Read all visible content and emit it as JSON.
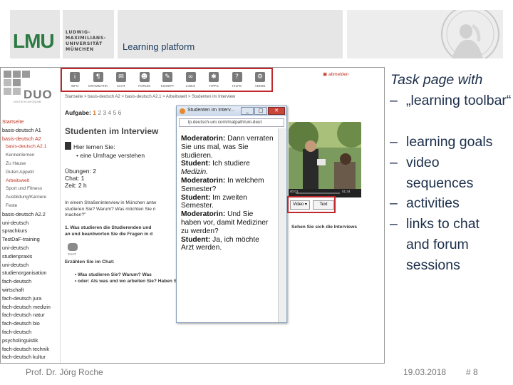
{
  "header": {
    "logo_text": "LMU",
    "university_name": [
      "LUDWIG-",
      "MAXIMILIANS-",
      "UNIVERSITÄT",
      "MÜNCHEN"
    ],
    "platform_label": "Learning platform"
  },
  "screenshot": {
    "toolbar": [
      {
        "icon": "info-icon",
        "label": "INFO"
      },
      {
        "icon": "grammar-icon",
        "label": "GRAMMATIK"
      },
      {
        "icon": "chat-icon",
        "label": "CHAT"
      },
      {
        "icon": "forum-icon",
        "label": "FORUM"
      },
      {
        "icon": "notebook-icon",
        "label": "KOSEPT"
      },
      {
        "icon": "links-icon",
        "label": "LINKS"
      },
      {
        "icon": "tips-icon",
        "label": "TIPPS"
      },
      {
        "icon": "help-icon",
        "label": "HILFE"
      },
      {
        "icon": "admin-icon",
        "label": "ADMIN"
      }
    ],
    "logout": "abmelden",
    "duo_logo": "DUO",
    "duo_tagline": "DEUTSCH UNI ONLINE",
    "breadcrumb": "Startseite > basis-deutsch A2 > basis-deutsch A2.1 > Arbeitswelt > Studenten im Interview",
    "task_label": "Aufgabe:",
    "task_current": "1",
    "task_pages": "2 3 4 5 6",
    "heading": "Studenten im Interview",
    "learn_title": "Hier lernen Sie:",
    "learn_item": "• eine Umfrage verstehen",
    "stats": [
      "Übungen: 2",
      "Chat: 1",
      "Zeit: 2 h"
    ],
    "intro_lines": [
      "In einem Straßeninterview in München antw",
      "studieren Sie? Warum? Was möchten Sie n",
      "machen?\""
    ],
    "question1_lines": [
      "1. Was studieren die Studierenden und",
      "an und beantworten Sie die Fragen in d"
    ],
    "question1_tail": "Sehen Sie sich die Interviews",
    "chat_label": "CHAT",
    "chat_prompt": "Erzählen Sie im Chat:",
    "chat_bullets": [
      "• Was studieren Sie? Warum? Was",
      "• oder: Als was und wo arbeiten Sie? Haben Sie studiert oder eine Ausbildung gemacht?"
    ],
    "sidebar": [
      {
        "text": "Startseite",
        "style": "red"
      },
      {
        "text": "basis-deutsch A1",
        "style": "normal"
      },
      {
        "text": "basis-deutsch A2",
        "style": "red"
      },
      {
        "text": "basis-deutsch A2.1",
        "style": "subred"
      },
      {
        "text": "Kennenlernen",
        "style": "sub"
      },
      {
        "text": "Zu Hause",
        "style": "sub"
      },
      {
        "text": "Guten Appetit",
        "style": "sub"
      },
      {
        "text": "Arbeitswelt",
        "style": "subred"
      },
      {
        "text": "Sport und Fitness",
        "style": "sub"
      },
      {
        "text": "Ausbildung/Karriere",
        "style": "sub"
      },
      {
        "text": "Feste",
        "style": "sub"
      },
      {
        "text": "basis-deutsch A2.2",
        "style": "normal"
      },
      {
        "text": "uni-deutsch",
        "style": "normal"
      },
      {
        "text": "sprachkurs",
        "style": "normal"
      },
      {
        "text": "TestDaF-training",
        "style": "normal"
      },
      {
        "text": "uni-deutsch",
        "style": "normal"
      },
      {
        "text": "studienpraxis",
        "style": "normal"
      },
      {
        "text": "uni-deutsch",
        "style": "normal"
      },
      {
        "text": "studienorganisation",
        "style": "normal"
      },
      {
        "text": "fach-deutsch",
        "style": "normal"
      },
      {
        "text": "wirtschaft",
        "style": "normal"
      },
      {
        "text": "fach-deutsch jura",
        "style": "normal"
      },
      {
        "text": "fach-deutsch medizin",
        "style": "normal"
      },
      {
        "text": "fach-deutsch natur",
        "style": "normal"
      },
      {
        "text": "fach-deutsch bio",
        "style": "normal"
      },
      {
        "text": "fach-deutsch",
        "style": "normal"
      },
      {
        "text": "psycholinguistik",
        "style": "normal"
      },
      {
        "text": "fach-deutsch technik",
        "style": "normal"
      },
      {
        "text": "fach-deutsch kultur",
        "style": "normal"
      }
    ],
    "popup": {
      "title": "Studenten im Interv...",
      "url": "lp.deutsch-uni.com/matpath/uni-deut",
      "transcript": [
        {
          "speaker": "Moderatorin:",
          "text": "Dann verraten"
        },
        {
          "speaker": "",
          "text": "Sie uns mal, was Sie"
        },
        {
          "speaker": "",
          "text": "studieren."
        },
        {
          "speaker": "Student:",
          "text": "Ich studiere"
        },
        {
          "speaker": "",
          "text": "Medizin.",
          "italic": true
        },
        {
          "speaker": "Moderatorin:",
          "text": "In welchem"
        },
        {
          "speaker": "",
          "text": "Semester?"
        },
        {
          "speaker": "Student:",
          "text": "Im zweiten"
        },
        {
          "speaker": "",
          "text": "Semester."
        },
        {
          "speaker": "Moderatorin:",
          "text": "Und Sie"
        },
        {
          "speaker": "",
          "text": "haben vor, damit Mediziner"
        },
        {
          "speaker": "",
          "text": "zu werden?"
        },
        {
          "speaker": "Student:",
          "text": "Ja, ich möchte"
        },
        {
          "speaker": "",
          "text": "Arzt werden."
        }
      ]
    },
    "video": {
      "time_start": "00:01",
      "time_end": "01:34",
      "mode_select": "Video",
      "text_button": "Text"
    }
  },
  "bullets": {
    "heading": "Task page with",
    "items": [
      "„learning toolbar“",
      "learning goals",
      "video sequences",
      "activities",
      "links to chat and forum sessions"
    ]
  },
  "footer": {
    "author": "Prof. Dr. Jörg Roche",
    "date": "19.03.2018",
    "page": "# 8"
  },
  "colors": {
    "lmu_green": "#2d7a44",
    "highlight_red": "#c0282e",
    "heading_blue": "#1b2e4a",
    "active_red": "#c03020"
  }
}
